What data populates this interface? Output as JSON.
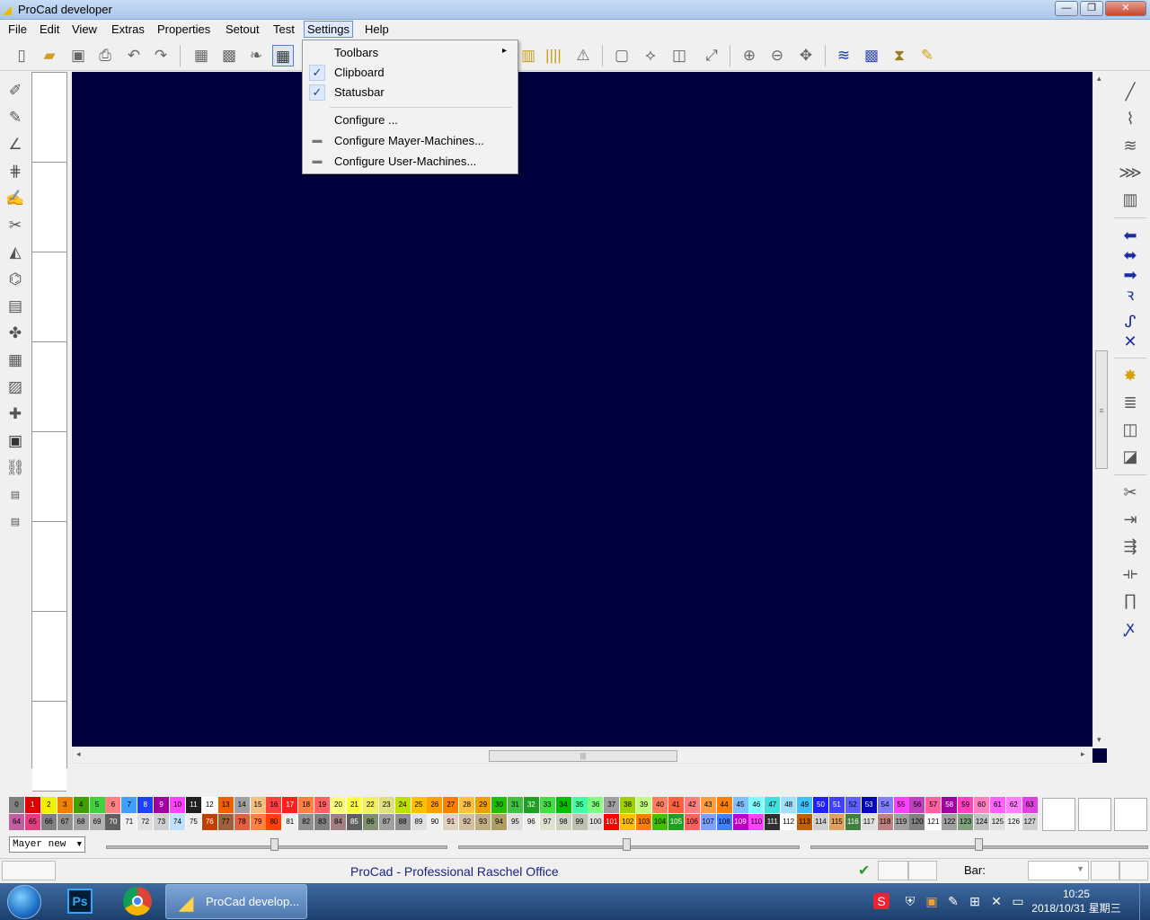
{
  "window": {
    "title": "ProCad developer",
    "buttons": [
      "—",
      "❐",
      "✕"
    ]
  },
  "menu": [
    "File",
    "Edit",
    "View",
    "Extras",
    "Properties",
    "Setout",
    "Test",
    "Settings",
    "Help"
  ],
  "settings_menu": {
    "toolbars": "Toolbars",
    "clipboard": "Clipboard",
    "statusbar": "Statusbar",
    "configure": "Configure ...",
    "configure_mayer": "Configure Mayer-Machines...",
    "configure_user": "Configure User-Machines...",
    "check_mark": "✓",
    "submenu_arrow": "▸",
    "clipboard_checked": true,
    "statusbar_checked": true
  },
  "icons": {
    "toolbar": [
      "new-file-icon",
      "open-folder-icon",
      "save-icon",
      "print-icon",
      "undo-icon",
      "redo-icon",
      "draw-fabric-icon",
      "fill-fabric-icon",
      "leaf-icon",
      "grid-icon",
      "bar-chart-icon",
      "barcode-icon",
      "warning-icon",
      "select-rect-icon",
      "select-shape-icon",
      "crop-icon",
      "transform-icon",
      "zoom-in-icon",
      "zoom-out-icon",
      "pan-icon",
      "yarn-icon",
      "pattern-icon",
      "spool-icon",
      "brush-icon"
    ]
  },
  "canvas_color": "#00003f",
  "palette": {
    "row1": [
      "0",
      "1",
      "2",
      "3",
      "4",
      "5",
      "6",
      "7",
      "8",
      "9",
      "10",
      "11",
      "12",
      "13",
      "14",
      "15",
      "16",
      "17",
      "18",
      "19",
      "20",
      "21",
      "22",
      "23",
      "24",
      "25",
      "26",
      "27",
      "28",
      "29",
      "30",
      "31",
      "32",
      "33",
      "34",
      "35",
      "36",
      "37",
      "38",
      "39",
      "40",
      "41",
      "42",
      "43",
      "44",
      "45",
      "46",
      "47",
      "48",
      "49",
      "50",
      "51",
      "52",
      "53",
      "54",
      "55",
      "56",
      "57",
      "58",
      "59",
      "60",
      "61",
      "62",
      "63"
    ],
    "row2": [
      "64",
      "65",
      "66",
      "67",
      "68",
      "69",
      "70",
      "71",
      "72",
      "73",
      "74",
      "75",
      "76",
      "77",
      "78",
      "79",
      "80",
      "81",
      "82",
      "83",
      "84",
      "85",
      "86",
      "87",
      "88",
      "89",
      "90",
      "91",
      "92",
      "93",
      "94",
      "95",
      "96",
      "97",
      "98",
      "99",
      "100",
      "101",
      "102",
      "103",
      "104",
      "105",
      "106",
      "107",
      "108",
      "109",
      "110",
      "111",
      "112",
      "113",
      "114",
      "115",
      "116",
      "117",
      "118",
      "119",
      "120",
      "121",
      "122",
      "123",
      "124",
      "125",
      "126",
      "127"
    ],
    "colors1": [
      "#808080",
      "#e00000",
      "#f0f000",
      "#f08000",
      "#40a000",
      "#40d040",
      "#ff8080",
      "#40a0ff",
      "#2040ff",
      "#a000a0",
      "#ff40ff",
      "#202020",
      "#ffffff",
      "#f06000",
      "#a0a0a0",
      "#f0c080",
      "#ff4040",
      "#ff2020",
      "#ff8040",
      "#ff6060",
      "#ffff80",
      "#ffff40",
      "#f0f060",
      "#e0e080",
      "#c0e000",
      "#ffc000",
      "#ffa000",
      "#ff8000",
      "#ffc040",
      "#f0a000",
      "#20c000",
      "#40c040",
      "#20a020",
      "#40e040",
      "#00c000",
      "#40ffa0",
      "#80ff80",
      "#a0a0a0",
      "#a0d000",
      "#c0ff80",
      "#ff8060",
      "#ff6040",
      "#ff8080",
      "#ffa040",
      "#ff8000",
      "#80c0ff",
      "#80ffff",
      "#40e0e0",
      "#a0e0ff",
      "#40c0ff",
      "#2020ff",
      "#4040ff",
      "#6060ff",
      "#0000c0",
      "#8080ff",
      "#ff40ff",
      "#c040c0",
      "#ff60a0",
      "#a000a0",
      "#ff40c0",
      "#ff80c0",
      "#ff60ff",
      "#ff80ff",
      "#e040e0"
    ],
    "colors2": [
      "#c060a0",
      "#e04080",
      "#808080",
      "#909090",
      "#a0a0a0",
      "#b0b0b0",
      "#606060",
      "#f0f0f0",
      "#e0e0e0",
      "#d0d0d0",
      "#c0e0ff",
      "#f0f0f0",
      "#c04000",
      "#a06040",
      "#e06040",
      "#ff8040",
      "#ff4000",
      "#f0f0f0",
      "#909090",
      "#808080",
      "#a08080",
      "#606060",
      "#809070",
      "#a0a0a0",
      "#909090",
      "#e0e0e0",
      "#f0f0f0",
      "#e0d0c0",
      "#d0c0a0",
      "#c0b080",
      "#b0a060",
      "#e0e0e0",
      "#f0f0f0",
      "#e0e0d0",
      "#d0d0c0",
      "#c0c0b0",
      "#e0e0e0",
      "#ff0000",
      "#ffc000",
      "#ff8000",
      "#40c000",
      "#20a020",
      "#ff6060",
      "#80a0ff",
      "#4080ff",
      "#c000c0",
      "#ff40ff",
      "#303030",
      "#ffffff",
      "#c06000",
      "#d0d0d0",
      "#e0a060",
      "#408040",
      "#e0e0e0",
      "#c08080",
      "#a0a0a0",
      "#808080",
      "#ffffff",
      "#a0a0a0",
      "#80a080",
      "#c0c0c0",
      "#e0e0e0",
      "#f0f0f0",
      "#d0d0d0"
    ]
  },
  "machine_select": "Mayer new",
  "status": {
    "text": "ProCad - Professional Raschel Office",
    "bar_label": "Bar:"
  },
  "taskbar": {
    "task_label": "ProCad develop...",
    "ps_label": "Ps",
    "time": "10:25",
    "date": "2018/10/31 星期三"
  }
}
